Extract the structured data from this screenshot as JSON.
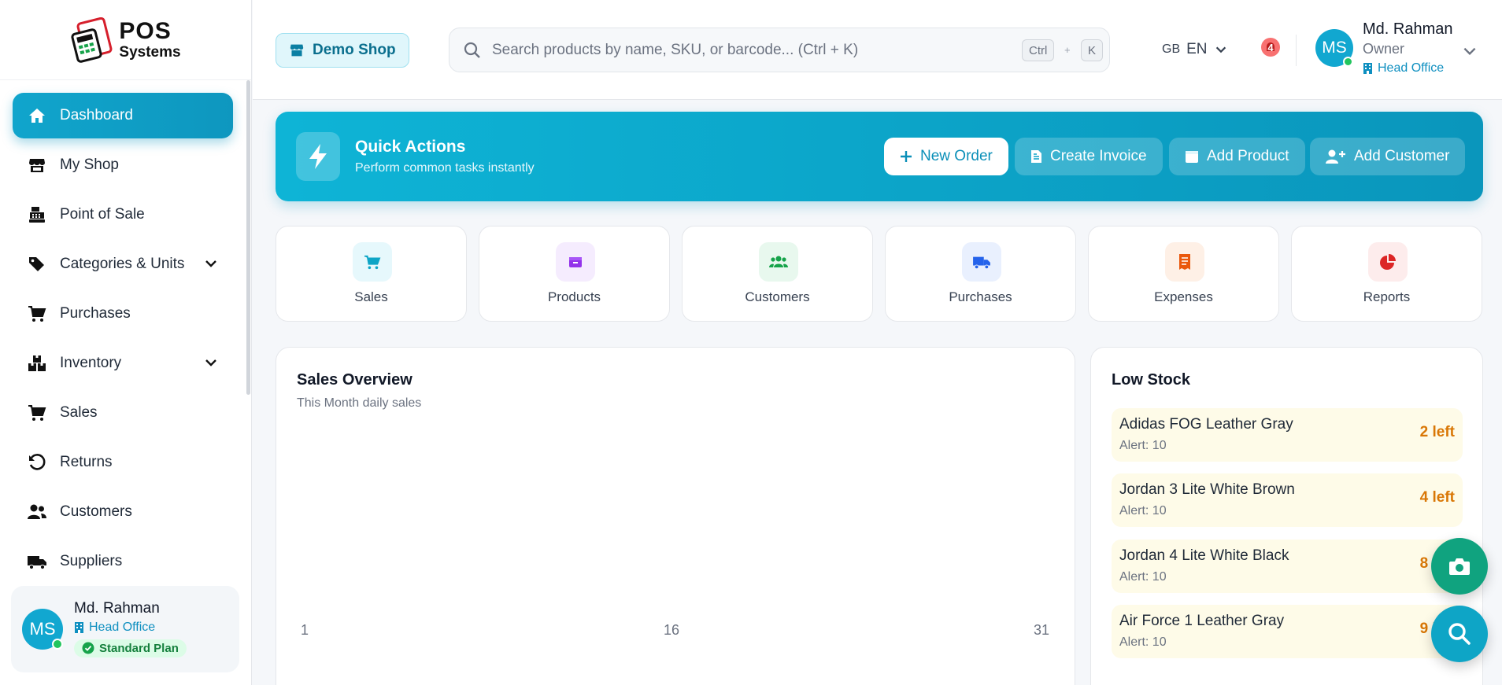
{
  "brand": {
    "line1": "POS",
    "line2": "Systems"
  },
  "sidebar": {
    "items": [
      {
        "label": "Dashboard",
        "icon": "home-icon",
        "active": true
      },
      {
        "label": "My Shop",
        "icon": "store-icon"
      },
      {
        "label": "Point of Sale",
        "icon": "cash-register-icon"
      },
      {
        "label": "Categories & Units",
        "icon": "tags-icon",
        "expandable": true
      },
      {
        "label": "Purchases",
        "icon": "cart-icon"
      },
      {
        "label": "Inventory",
        "icon": "boxes-icon",
        "expandable": true
      },
      {
        "label": "Sales",
        "icon": "cart-icon"
      },
      {
        "label": "Returns",
        "icon": "undo-icon"
      },
      {
        "label": "Customers",
        "icon": "users-icon"
      },
      {
        "label": "Suppliers",
        "icon": "truck-icon"
      }
    ],
    "user": {
      "initials": "MS",
      "name": "Md. Rahman",
      "office": "Head Office",
      "plan": "Standard Plan"
    }
  },
  "header": {
    "shop": "Demo Shop",
    "search": {
      "placeholder": "Search products by name, SKU, or barcode... (Ctrl + K)",
      "kbd1": "Ctrl",
      "plus": "+",
      "kbd2": "K"
    },
    "lang": {
      "flag": "GB",
      "code": "EN"
    },
    "notifications": "4",
    "user": {
      "initials": "MS",
      "name": "Md. Rahman",
      "role": "Owner",
      "office": "Head Office"
    }
  },
  "quick_actions": {
    "title": "Quick Actions",
    "subtitle": "Perform common tasks instantly",
    "buttons": [
      "New Order",
      "Create Invoice",
      "Add Product",
      "Add Customer"
    ]
  },
  "modules": [
    {
      "label": "Sales",
      "color": "#0ea5c6",
      "bg": "#e6f8fc"
    },
    {
      "label": "Products",
      "color": "#9333ea",
      "bg": "#f5ecfe"
    },
    {
      "label": "Customers",
      "color": "#16a34a",
      "bg": "#e8f8ee"
    },
    {
      "label": "Purchases",
      "color": "#2563eb",
      "bg": "#e9f0fe"
    },
    {
      "label": "Expenses",
      "color": "#ea580c",
      "bg": "#fef0e6"
    },
    {
      "label": "Reports",
      "color": "#dc2626",
      "bg": "#fdecec"
    }
  ],
  "sales_overview": {
    "title": "Sales Overview",
    "subtitle": "This Month daily sales",
    "chart_data": {
      "type": "line",
      "x_ticks": [
        "1",
        "16",
        "31"
      ],
      "series": []
    }
  },
  "low_stock": {
    "title": "Low Stock",
    "items": [
      {
        "name": "Adidas FOG Leather Gray",
        "alert": "Alert: 10",
        "left": "2 left"
      },
      {
        "name": "Jordan 3 Lite White Brown",
        "alert": "Alert: 10",
        "left": "4 left"
      },
      {
        "name": "Jordan 4 Lite White Black",
        "alert": "Alert: 10",
        "left": "8 left"
      },
      {
        "name": "Air Force 1 Leather Gray",
        "alert": "Alert: 10",
        "left": "9 left"
      }
    ]
  },
  "colors": {
    "accent": "#0ea5c6",
    "fab_camera": "#10a37f",
    "fab_search": "#0ea5c6"
  }
}
